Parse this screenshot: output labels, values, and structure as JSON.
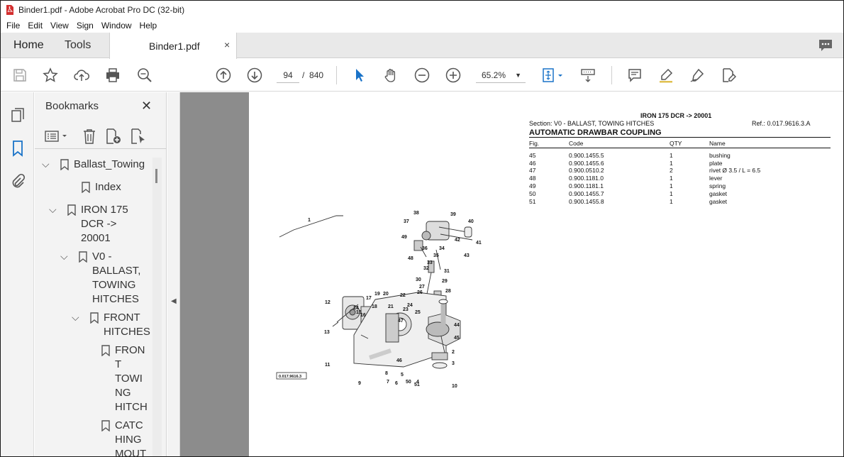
{
  "window": {
    "title": "Binder1.pdf - Adobe Acrobat Pro DC (32-bit)"
  },
  "menu": [
    "File",
    "Edit",
    "View",
    "Sign",
    "Window",
    "Help"
  ],
  "tabs": {
    "home": "Home",
    "tools": "Tools",
    "document": "Binder1.pdf",
    "close": "×"
  },
  "toolbar": {
    "current_page": "94",
    "separator": "/",
    "total_pages": "840",
    "zoom": "65.2%"
  },
  "bookmarks": {
    "title": "Bookmarks",
    "close": "✕",
    "tree": [
      {
        "label": "Ballast_Towing",
        "level": 0,
        "expanded": true
      },
      {
        "label": "Index",
        "level": 1,
        "expanded": null
      },
      {
        "label": "IRON 175\nDCR ->\n20001",
        "level": 1,
        "expanded": true
      },
      {
        "label": "V0 -\nBALLAST,\nTOWING\nHITCHES",
        "level": 2,
        "expanded": true
      },
      {
        "label": "FRONT\nHITCHES",
        "level": 3,
        "expanded": true
      },
      {
        "label": "FRON\nT\nTOWI\nNG\nHITCH",
        "level": 4,
        "expanded": null
      },
      {
        "label": "CATC\nHING\nMOUT",
        "level": 4,
        "expanded": null
      }
    ]
  },
  "document": {
    "model": "IRON 175 DCR -> 20001",
    "section": "Section: V0 - BALLAST, TOWING HITCHES",
    "ref": "Ref.: 0.017.9616.3.A",
    "heading": "AUTOMATIC DRAWBAR COUPLING",
    "columns": [
      "Fig.",
      "Code",
      "QTY",
      "Name"
    ],
    "parts": [
      [
        "45",
        "0.900.1455.5",
        "1",
        "bushing"
      ],
      [
        "46",
        "0.900.1455.6",
        "1",
        "plate"
      ],
      [
        "47",
        "0.900.0510.2",
        "2",
        "rivet Ø 3.5 / L = 6.5"
      ],
      [
        "48",
        "0.900.1181.0",
        "1",
        "lever"
      ],
      [
        "49",
        "0.900.1181.1",
        "1",
        "spring"
      ],
      [
        "50",
        "0.900.1455.7",
        "1",
        "gasket"
      ],
      [
        "51",
        "0.900.1455.8",
        "1",
        "gasket"
      ]
    ],
    "diagram_id": "0.017.9616.3",
    "diagram_callouts": [
      "1",
      "38",
      "39",
      "40",
      "37",
      "41",
      "49",
      "42",
      "36",
      "34",
      "43",
      "48",
      "35",
      "33",
      "32",
      "31",
      "30",
      "29",
      "27",
      "28",
      "26",
      "19",
      "20",
      "17",
      "18",
      "21",
      "22",
      "23",
      "24",
      "25",
      "12",
      "14",
      "15",
      "16",
      "47",
      "44",
      "13",
      "45",
      "2",
      "46",
      "3",
      "11",
      "8",
      "7",
      "6",
      "5",
      "50",
      "51",
      "4",
      "10",
      "9"
    ]
  }
}
